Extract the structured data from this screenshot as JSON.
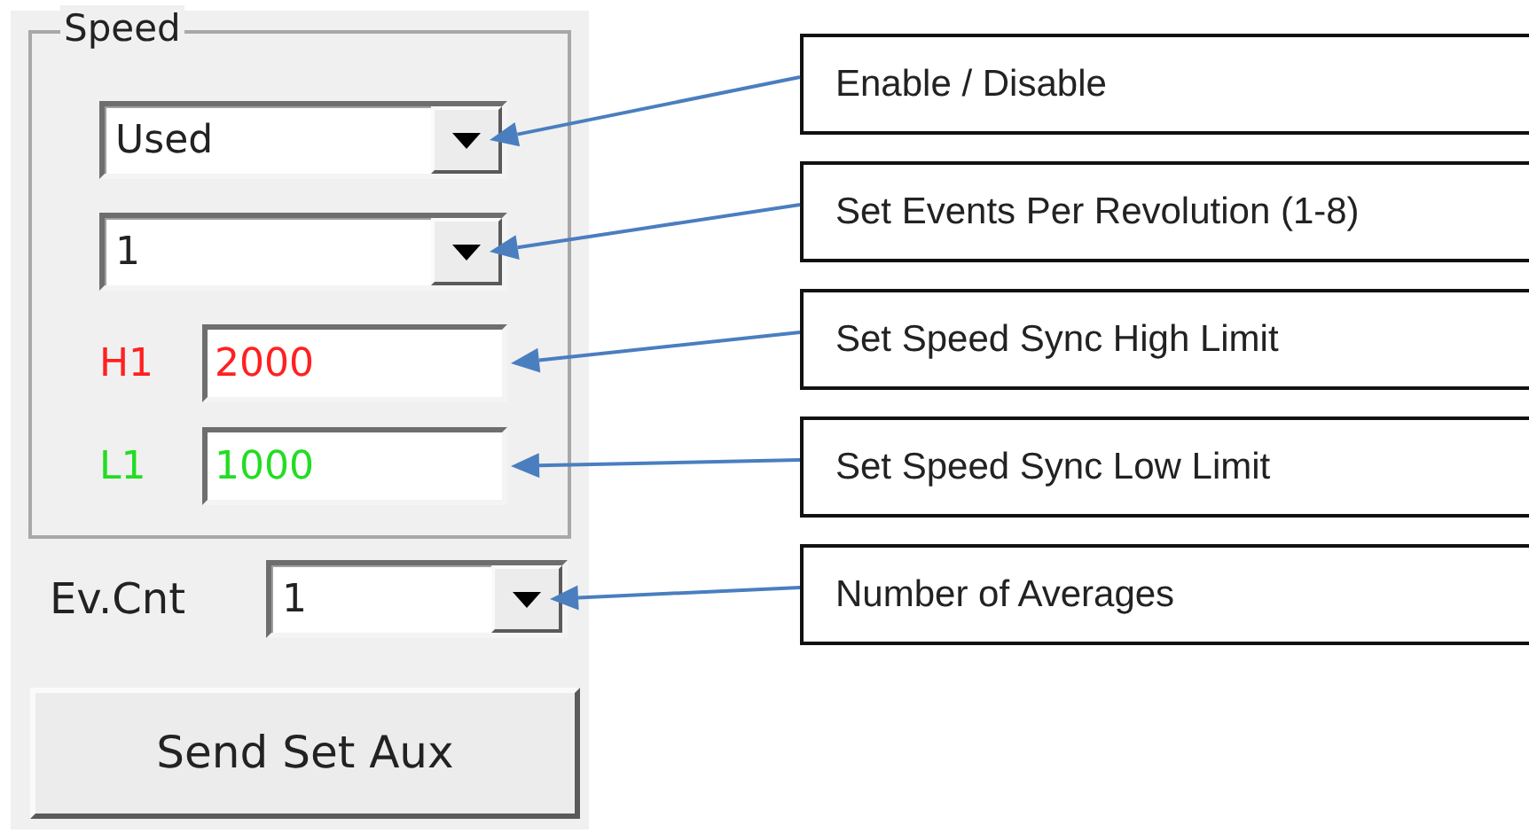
{
  "group": {
    "title": "Speed"
  },
  "controls": [
    {
      "kind": "combo",
      "value": "Used"
    },
    {
      "kind": "combo",
      "value": "1"
    },
    {
      "kind": "field",
      "label": "H1",
      "value": "2000",
      "color": "#ff2020"
    },
    {
      "kind": "field",
      "label": "L1",
      "value": "1000",
      "color": "#22dd22"
    }
  ],
  "ev_cnt": {
    "label": "Ev.Cnt",
    "value": "1"
  },
  "button": "Send Set Aux",
  "callouts": [
    "Enable / Disable",
    "Set Events Per Revolution (1-8)",
    "Set Speed Sync High Limit",
    "Set Speed Sync Low Limit",
    "Number of Averages"
  ]
}
